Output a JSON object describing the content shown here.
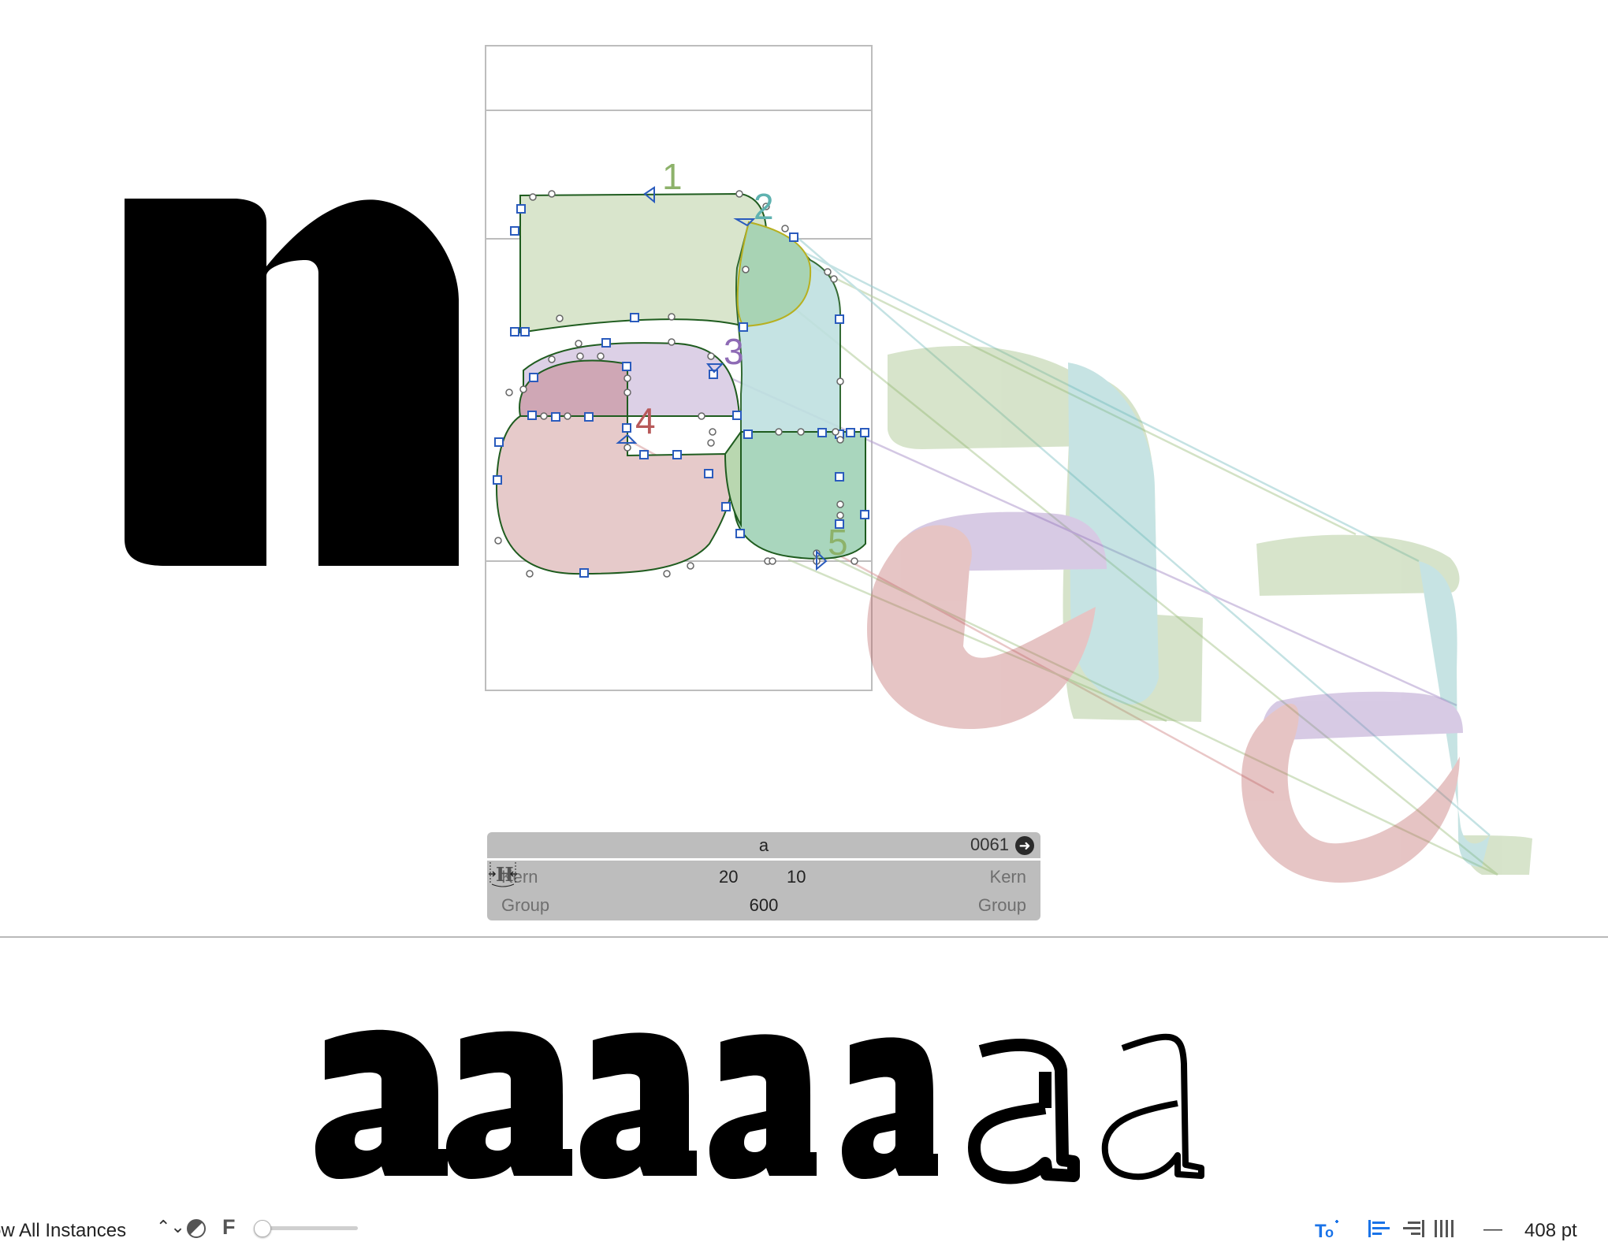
{
  "glyph_panel": {
    "name": "a",
    "unicode": "0061",
    "left_kern_label": "Kern",
    "right_kern_label": "Kern",
    "left_group_label": "Group",
    "right_group_label": "Group",
    "lsb": "20",
    "rsb": "10",
    "width": "600"
  },
  "canvas": {
    "text_glyph": "n",
    "path_numbers": [
      "1",
      "2",
      "3",
      "4",
      "5"
    ],
    "path_colors": [
      "#8db26a",
      "#5fb2b0",
      "#8e6bb5",
      "#b85a5a",
      "#8db26a"
    ]
  },
  "preview": {
    "glyphs": [
      "a",
      "a",
      "a",
      "a",
      "a",
      "a",
      "a"
    ],
    "weights": [
      "heaviest",
      "black",
      "extrabold",
      "bold",
      "semibold",
      "regular",
      "light"
    ]
  },
  "toolbar": {
    "instances_label": "ow All Instances",
    "updown_glyph": "⌃⌄",
    "font_label": "F",
    "slider_value": 0,
    "size_label": "408 pt",
    "minus_label": "—",
    "accent_color": "#1a73e8",
    "icons": [
      "contrast-icon",
      "text-tool-icon",
      "align-left-icon",
      "align-right-icon",
      "justify-icon"
    ]
  }
}
